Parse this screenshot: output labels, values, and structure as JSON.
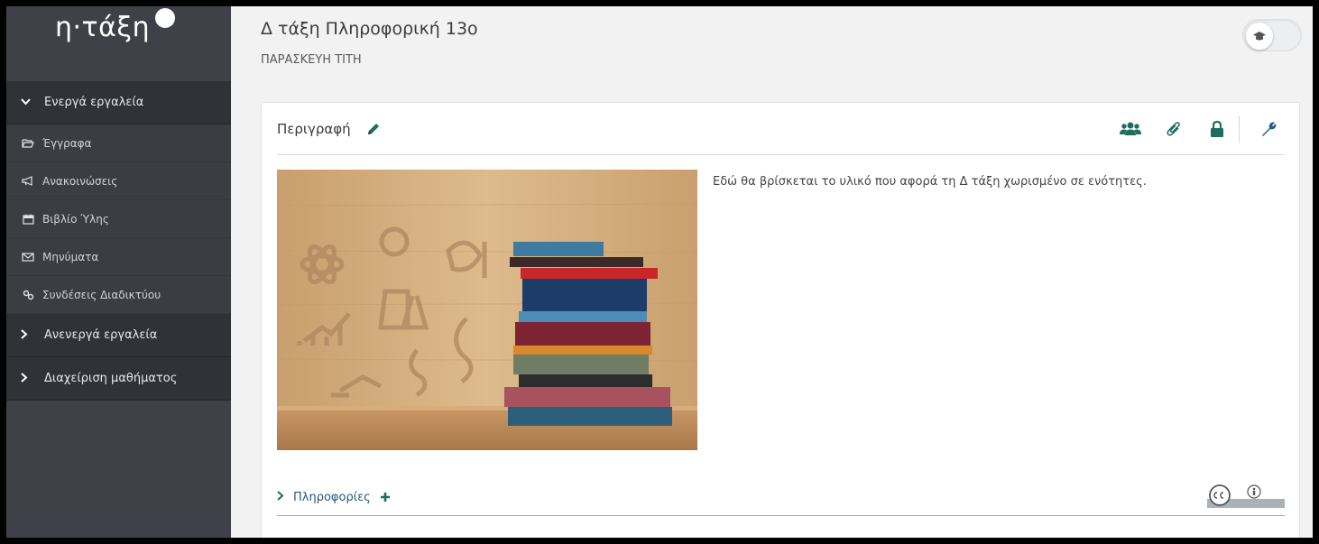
{
  "logo": {
    "text": "η·τάξη"
  },
  "sidebar": {
    "active_tools": {
      "label": "Ενεργά εργαλεία"
    },
    "items": [
      {
        "label": "Έγγραφα",
        "icon": "folder-open-icon"
      },
      {
        "label": "Ανακοινώσεις",
        "icon": "bullhorn-icon"
      },
      {
        "label": "Βιβλίο Ύλης",
        "icon": "calendar-icon"
      },
      {
        "label": "Μηνύματα",
        "icon": "envelope-icon"
      },
      {
        "label": "Συνδέσεις Διαδικτύου",
        "icon": "link-icon"
      }
    ],
    "inactive_tools": {
      "label": "Ανενεργά εργαλεία"
    },
    "course_admin": {
      "label": "Διαχείριση μαθήματος"
    }
  },
  "header": {
    "course_title": "Δ τάξη Πληροφορική 13ο",
    "teacher": "ΠΑΡΑΣΚΕΥΗ ΤΙΤΗ"
  },
  "panel": {
    "title": "Περιγραφή",
    "description": "Εδώ θα βρίσκεται το υλικό που αφορά τη Δ τάξη χωρισμένο σε ενότητες.",
    "info_label": "Πληροφορίες",
    "tools": [
      "users-icon",
      "paperclip-icon",
      "lock-icon",
      "wrench-icon"
    ]
  },
  "colors": {
    "sidebar_bg": "#3e4147",
    "sidebar_header_bg": "#2f3236",
    "accent_green": "#1f6d60",
    "link_blue": "#23597a"
  }
}
